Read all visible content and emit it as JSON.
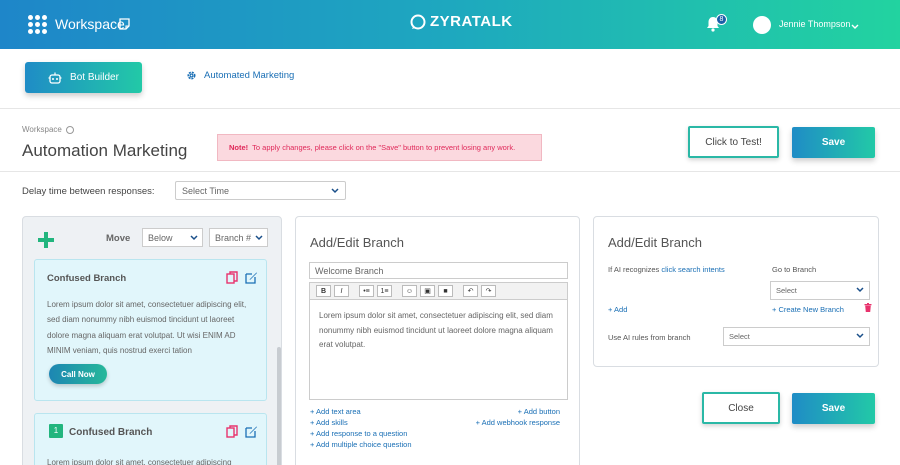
{
  "topbar": {
    "workspace_label": "Workspace",
    "logo_text": "ZYRATALK",
    "notification_count": "8",
    "user_name": "Jennie Thompson"
  },
  "subnav": {
    "bot_builder_label": "Bot Builder",
    "automated_marketing_label": "Automated Marketing"
  },
  "header": {
    "breadcrumb": "Workspace",
    "title": "Automation Marketing",
    "notice_bold": "Note!",
    "notice_text": "To apply changes, please click on the \"Save\" button to prevent losing any work.",
    "test_button": "Click to Test!",
    "save_button": "Save"
  },
  "delay": {
    "label": "Delay time between responses:",
    "placeholder": "Select Time"
  },
  "branch_list": {
    "move_label": "Move",
    "move_position": "Below",
    "branch_select": "Branch #",
    "cards": [
      {
        "title": "Confused Branch",
        "text": "Lorem ipsum dolor sit amet, consectetuer adipiscing elit, sed diam nonummy nibh euismod tincidunt ut laoreet dolore magna aliquam erat volutpat. Ut wisi ENIM AD MINIM veniam, quis nostrud exerci tation",
        "button": "Call Now"
      },
      {
        "number": "1",
        "title": "Confused Branch",
        "text": "Lorem ipsum dolor sit amet, consectetuer adipiscing"
      }
    ]
  },
  "editor_panel": {
    "title": "Add/Edit Branch",
    "branch_name": "Welcome Branch",
    "toolbar": [
      "B",
      "I",
      "•≡",
      "1≡",
      "☺",
      "▣",
      "■",
      "↶",
      "↷"
    ],
    "content": "Lorem ipsum dolor sit amet, consectetuer adipiscing elit, sed diam nonummy nibh euismod tincidunt ut laoreet dolore magna aliquam erat volutpat.",
    "links_left": [
      "+ Add text area",
      "+ Add skills",
      "+ Add response to a question",
      "+ Add multiple choice question"
    ],
    "links_right": [
      "+ Add button",
      "+ Add webhook response"
    ]
  },
  "ai_panel": {
    "title": "Add/Edit Branch",
    "recognizes_prefix": "If AI recognizes",
    "recognizes_link": "click search intents",
    "goto_label": "Go to Branch",
    "goto_select": "Select",
    "add_link": "+ Add",
    "create_link": "+ Create New Branch",
    "use_rules_label": "Use AI rules from branch",
    "use_rules_select": "Select",
    "close_button": "Close",
    "save_button": "Save"
  },
  "colors": {
    "gradient_start": "#1e86c9",
    "gradient_end": "#22d3a0",
    "link": "#1a6fb5",
    "notice_bg": "#fbd9df",
    "notice_text": "#e0295a",
    "accent_green": "#22b57e",
    "icon_pink": "#e8336d"
  }
}
